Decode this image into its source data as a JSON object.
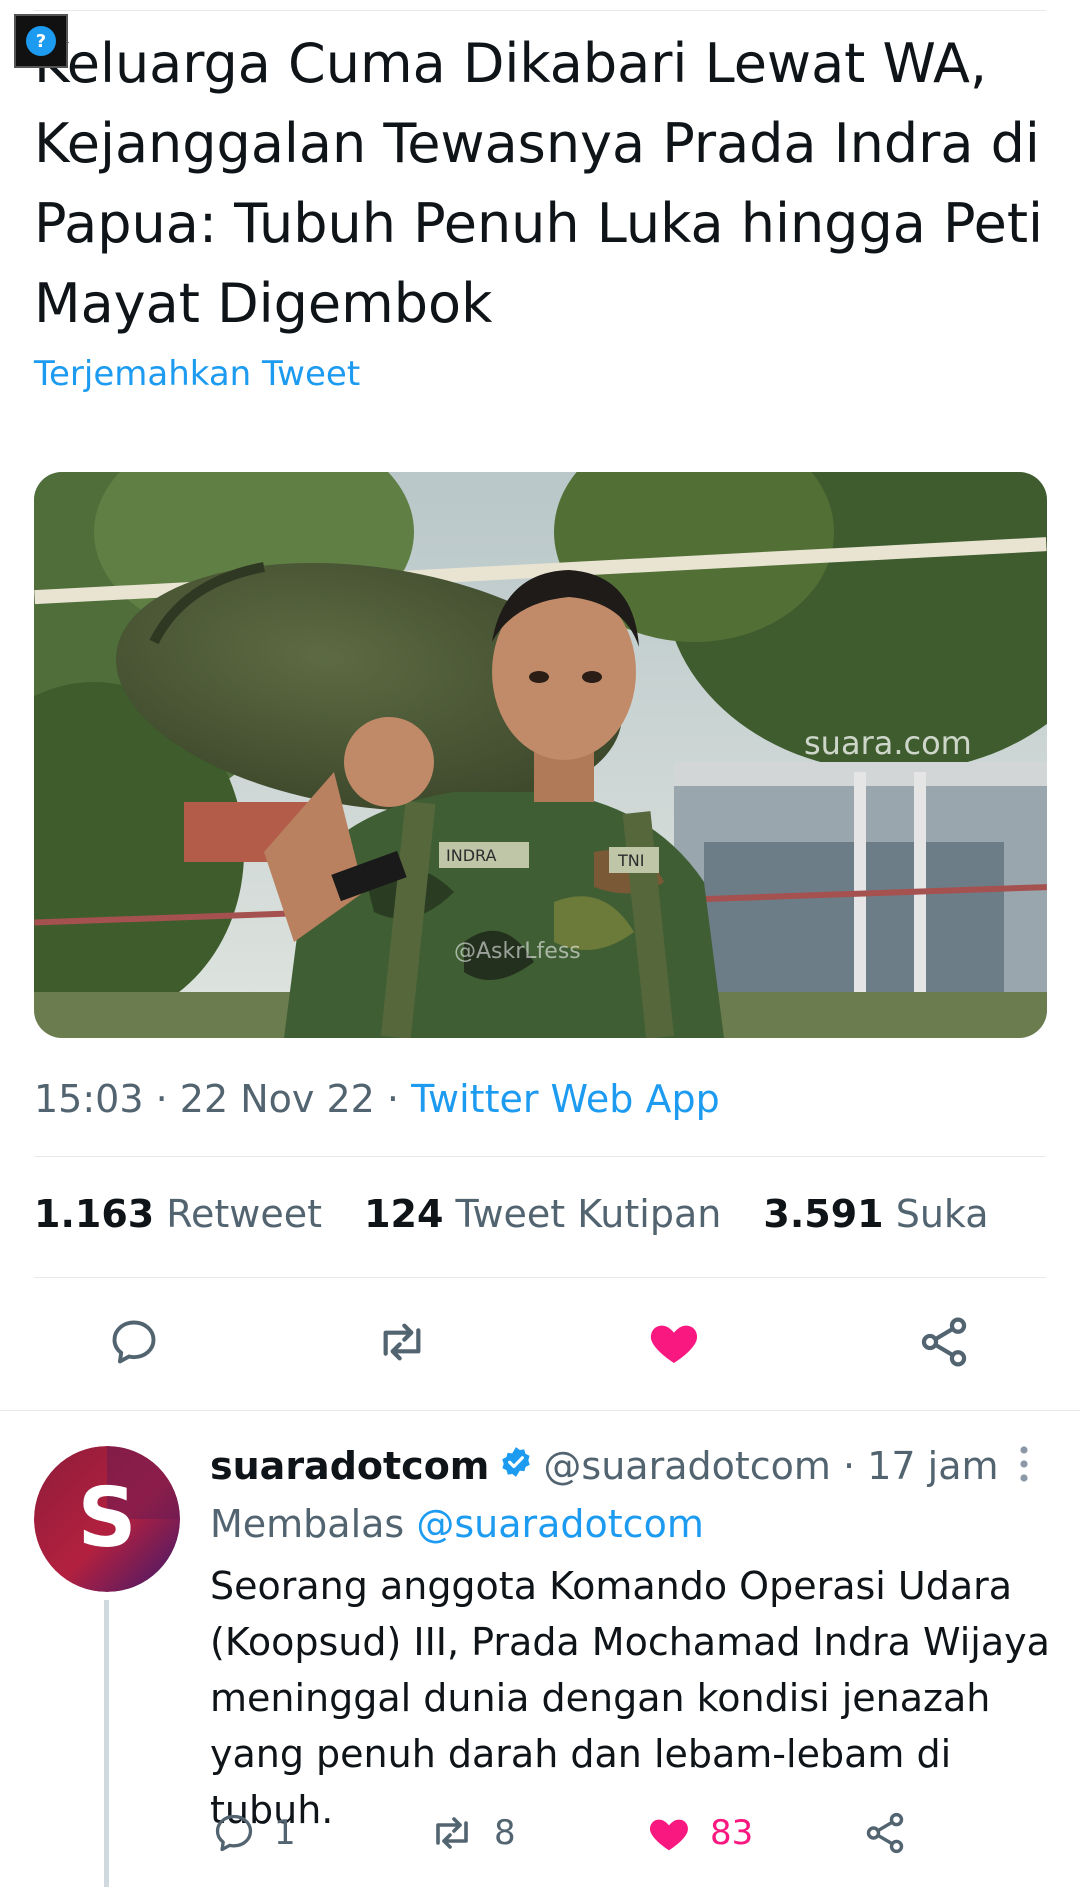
{
  "tweet": {
    "headline": "Keluarga Cuma Dikabari Lewat WA, Kejanggalan Tewasnya Prada Indra di Papua: Tubuh Penuh Luka hingga Peti Mayat Digembok",
    "translate_label": "Terjemahkan Tweet",
    "media": {
      "watermark_site": "suara.com",
      "watermark_account": "@AskrLfess",
      "name_tag": "INDRA",
      "unit_tag": "TNI"
    },
    "time": "15:03",
    "date": "22 Nov 22",
    "source": "Twitter Web App",
    "separator": "·",
    "stats": {
      "retweet_count": "1.163",
      "retweet_label": "Retweet",
      "quote_count": "124",
      "quote_label": "Tweet Kutipan",
      "like_count": "3.591",
      "like_label": "Suka"
    }
  },
  "reply": {
    "avatar_letter": "S",
    "name": "suaradotcom",
    "handle": "@suaradotcom",
    "separator": "·",
    "time": "17 jam",
    "replying_label": "Membalas",
    "replying_to": "@suaradotcom",
    "text": "Seorang anggota Komando Operasi Udara (Koopsud) III, Prada Mochamad Indra Wijaya meninggal dunia dengan kondisi jenazah yang penuh darah dan lebam-lebam di tubuh.",
    "reply_count": "1",
    "retweet_count": "8",
    "like_count": "83"
  },
  "icons": {
    "corner": "question-badge-icon",
    "reply": "reply-icon",
    "retweet": "retweet-icon",
    "like": "heart-icon",
    "share": "share-icon",
    "verified": "verified-badge-icon",
    "more": "more-vertical-icon"
  },
  "corner_badge_glyph": "?",
  "colors": {
    "accent": "#1d9bf0",
    "like": "#f91880",
    "secondary_text": "#536471",
    "primary_text": "#0f1419"
  }
}
